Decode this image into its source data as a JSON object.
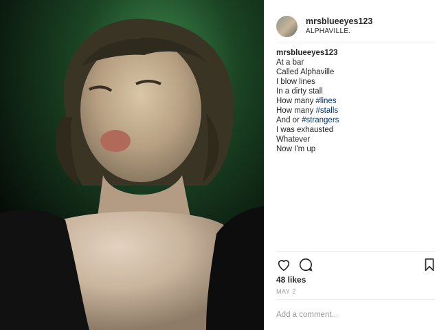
{
  "header": {
    "username": "mrsblueeyes123",
    "location": "ALPHAVILLE."
  },
  "caption": {
    "username": "mrsblueeyes123",
    "lines": [
      "At a bar",
      "Called Alphaville",
      "I blow lines",
      "In a dirty stall"
    ],
    "tag_lines": [
      {
        "prefix": "How many ",
        "tag": "#lines"
      },
      {
        "prefix": "How many ",
        "tag": "#stalls"
      },
      {
        "prefix": "And or ",
        "tag": "#strangers"
      }
    ],
    "end_lines": [
      "I was exhausted",
      "Whatever",
      "Now I'm up"
    ]
  },
  "likes": "48 likes",
  "date": "MAY 2",
  "comment": {
    "placeholder": "Add a comment..."
  },
  "icons": {
    "like": "heart-icon",
    "comment": "comment-bubble-icon",
    "save": "bookmark-icon"
  },
  "colors": {
    "hashtag": "#003569",
    "muted": "#999999",
    "text": "#262626",
    "divider": "#efefef"
  }
}
